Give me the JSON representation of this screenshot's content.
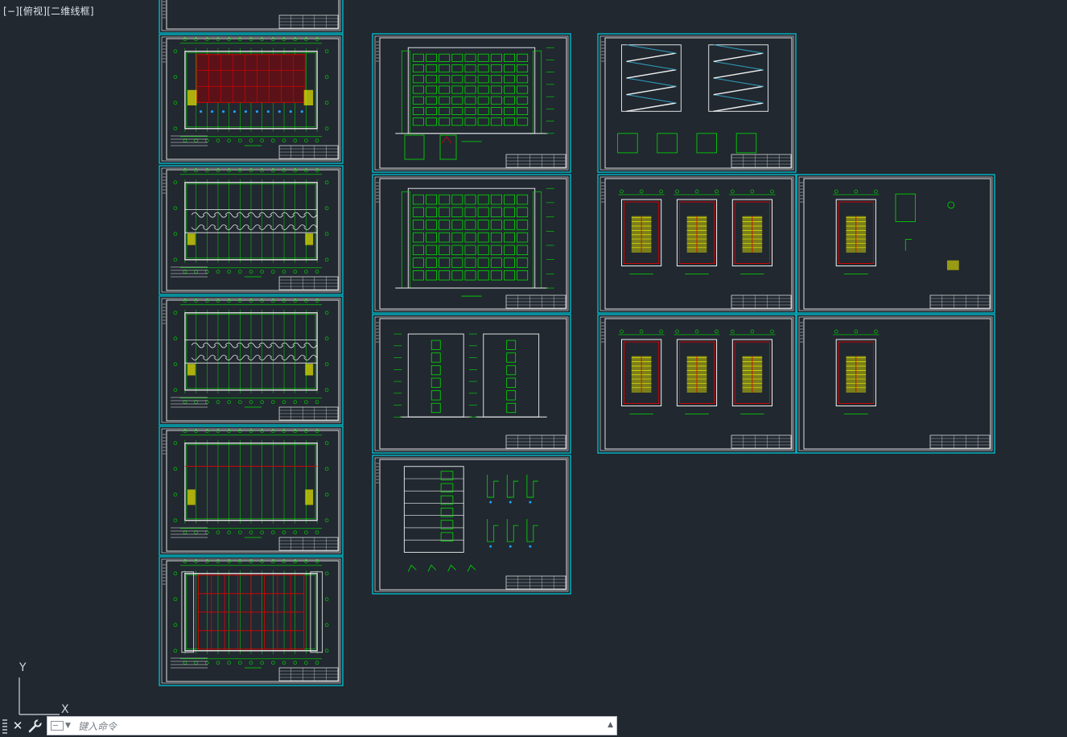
{
  "viewport_label": {
    "parts": [
      "[−]",
      "[俯视]",
      "[二维线框]"
    ]
  },
  "ucs": {
    "y_label": "Y",
    "x_label": "X"
  },
  "command_line": {
    "placeholder": "键入命令",
    "close_icon": "close-icon",
    "settings_icon": "wrench-icon"
  },
  "colors": {
    "background": "#212830",
    "sheet_border": "#00b8c8",
    "drawing_green": "#00e000",
    "drawing_red": "#e00000",
    "drawing_yellow": "#e8e800",
    "drawing_white": "#f2f2f2"
  },
  "sheets": [
    {
      "name": "floor-plan-partial-top",
      "type": "blank"
    },
    {
      "name": "ground-floor-plan",
      "type": "plan",
      "fill": "red"
    },
    {
      "name": "second-floor-plan",
      "type": "plan",
      "fill": "rooms"
    },
    {
      "name": "standard-floor-plan",
      "type": "plan",
      "fill": "rooms"
    },
    {
      "name": "top-floor-plan",
      "type": "plan",
      "fill": "stairs"
    },
    {
      "name": "roof-plan",
      "type": "plan",
      "fill": "roof"
    },
    {
      "name": "front-elevation",
      "type": "elevation",
      "details": true
    },
    {
      "name": "rear-elevation",
      "type": "elevation",
      "details": false
    },
    {
      "name": "side-elevations",
      "type": "side"
    },
    {
      "name": "section-and-details",
      "type": "section"
    },
    {
      "name": "stair-sections",
      "type": "stair-section"
    },
    {
      "name": "stair-plans-a",
      "type": "stair-plans",
      "count": 3
    },
    {
      "name": "stair-plan-details",
      "type": "stair-plans",
      "count": 1,
      "details": true
    },
    {
      "name": "stair-plans-b",
      "type": "stair-plans",
      "count": 3
    },
    {
      "name": "stair-plan-single",
      "type": "stair-plans",
      "count": 1
    }
  ]
}
